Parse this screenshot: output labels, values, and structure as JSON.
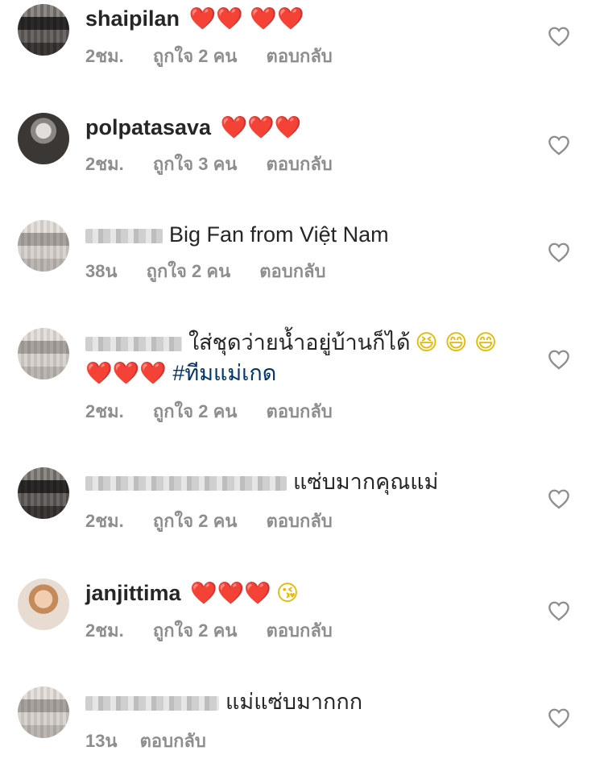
{
  "comments": [
    {
      "username": "shaipilan",
      "text": "❤️❤️ ❤️❤️",
      "time": "2ชม.",
      "likes": "ถูกใจ 2 คน",
      "reply": "ตอบกลับ"
    },
    {
      "username": "polpatasava",
      "text": "❤️❤️❤️",
      "time": "2ชม.",
      "likes": "ถูกใจ 3 คน",
      "reply": "ตอบกลับ"
    },
    {
      "username": "",
      "text": "Big Fan from Việt Nam",
      "time": "38น",
      "likes": "ถูกใจ 2 คน",
      "reply": "ตอบกลับ"
    },
    {
      "username": "",
      "text": "ใส่ชุดว่ายน้ำอยู่บ้านก็ได้",
      "emojis": "😆 😄 😄",
      "text2_hearts": "❤️❤️❤️",
      "hashtag": "#ทีมแม่เกด",
      "time": "2ชม.",
      "likes": "ถูกใจ 2 คน",
      "reply": "ตอบกลับ"
    },
    {
      "username": "",
      "text": "แซ่บมากคุณแม่",
      "time": "2ชม.",
      "likes": "ถูกใจ 2 คน",
      "reply": "ตอบกลับ"
    },
    {
      "username": "janjittima",
      "text": "❤️❤️❤️",
      "emojis": "😘",
      "time": "2ชม.",
      "likes": "ถูกใจ 2 คน",
      "reply": "ตอบกลับ"
    },
    {
      "username": "",
      "text": "แม่แซ่บมากกก",
      "time": "13น",
      "reply": "ตอบกลับ"
    }
  ]
}
